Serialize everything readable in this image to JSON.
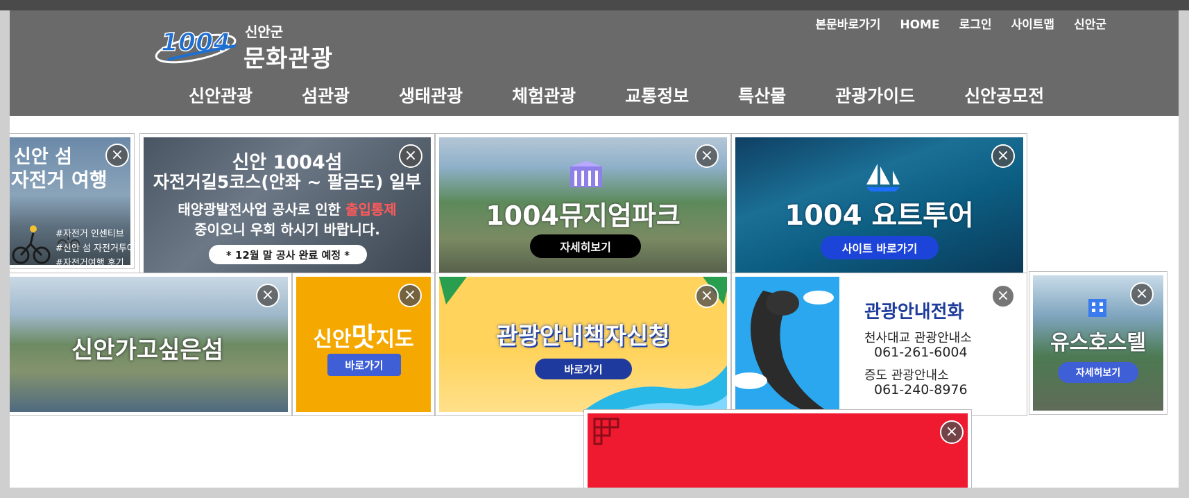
{
  "header": {
    "logo_mark_text": "1004",
    "logo_sub": "신안군",
    "logo_title": "문화관광",
    "util_nav": [
      "본문바로가기",
      "HOME",
      "로그인",
      "사이트맵",
      "신안군"
    ],
    "gnb": [
      "신안관광",
      "섬관광",
      "생태관광",
      "체험관광",
      "교통정보",
      "특산물",
      "관광가이드",
      "신안공모전"
    ]
  },
  "banners": {
    "bike": {
      "title1": "신안 섬",
      "title2": "자전거 여행",
      "tags": [
        "#자전거 인센티브",
        "#신안 섬 자전거투어",
        "#자전거여행 후기"
      ]
    },
    "road": {
      "title1": "신안 1004섬",
      "title2": "자전거길5코스(안좌 ~ 팔금도) 일부",
      "line1a": "태양광발전사업 공사로 인한 ",
      "line1b": "출입통제",
      "line2": "중이오니 우회 하시기 바랍니다.",
      "note": "* 12월 말 공사 완료 예정 *"
    },
    "museum": {
      "title": "1004뮤지엄파크",
      "button": "자세히보기"
    },
    "yacht": {
      "title": "1004 요트투어",
      "button": "사이트 바로가기"
    },
    "island": {
      "title": "신안가고싶은섬"
    },
    "food": {
      "title_a": "신안",
      "title_b": "맛",
      "title_c": "지도",
      "button": "바로가기"
    },
    "guidebook": {
      "title": "관광안내책자신청",
      "button": "바로가기"
    },
    "phone": {
      "title": "관광안내전화",
      "items": [
        {
          "name": "천사대교 관광안내소",
          "number": "061-261-6004"
        },
        {
          "name": "증도 관광안내소",
          "number": "061-240-8976"
        }
      ]
    },
    "hostel": {
      "title": "유스호스텔",
      "button": "자세히보기"
    }
  },
  "close_glyph": "×",
  "colors": {
    "header_bg": "#6a6a6a",
    "accent_red": "#ff4a4a",
    "food_bg": "#f5a800",
    "guide_bg": "#ffd35c",
    "blue_button": "#3f5fd6",
    "red_banner": "#ef1a30"
  }
}
